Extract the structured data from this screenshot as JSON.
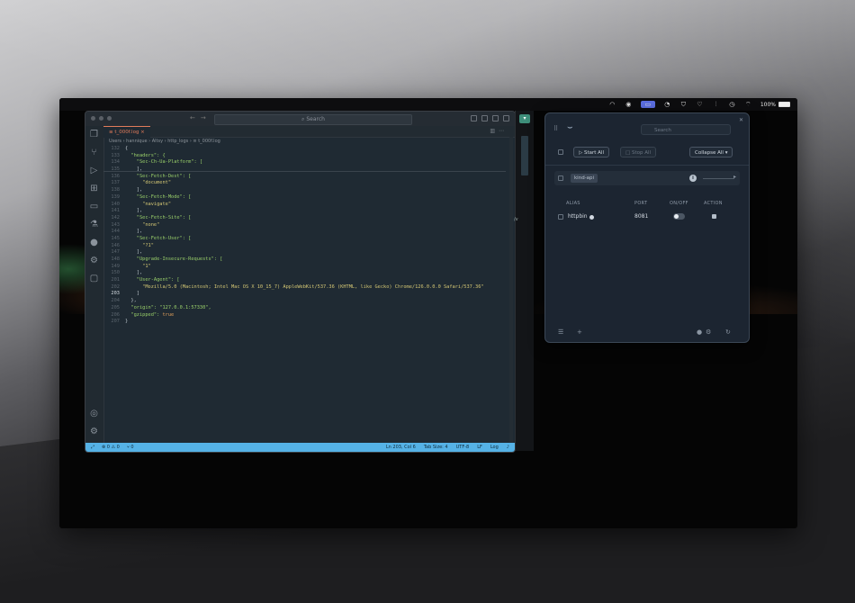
{
  "menubar": {
    "battery_text": "100%",
    "icons": [
      "menu-extra-icon",
      "record-icon",
      "port-manager-icon",
      "timer-icon",
      "shield-icon",
      "heart-monitor-icon",
      "audio-icon",
      "clock-icon",
      "wifi-icon"
    ]
  },
  "editor": {
    "search_placeholder": "Search",
    "tab_label": "t_000f.log",
    "breadcrumb": "Users  ›  hannique  ›  Altsy  ›  http_logs  ›  ≡ t_000f.log",
    "lines": [
      {
        "n": "132",
        "t": "{"
      },
      {
        "n": "133",
        "t": "  \"headers\": {"
      },
      {
        "n": "134",
        "t": "    \"Sec-Ch-Ua-Platform\": ["
      },
      {
        "n": "135",
        "t": "    ],"
      },
      {
        "n": "136",
        "t": "    \"Sec-Fetch-Dest\": ["
      },
      {
        "n": "137",
        "t": "      \"document\""
      },
      {
        "n": "138",
        "t": "    ],"
      },
      {
        "n": "139",
        "t": "    \"Sec-Fetch-Mode\": ["
      },
      {
        "n": "140",
        "t": "      \"navigate\""
      },
      {
        "n": "141",
        "t": "    ],"
      },
      {
        "n": "142",
        "t": "    \"Sec-Fetch-Site\": ["
      },
      {
        "n": "143",
        "t": "      \"none\""
      },
      {
        "n": "144",
        "t": "    ],"
      },
      {
        "n": "145",
        "t": "    \"Sec-Fetch-User\": ["
      },
      {
        "n": "146",
        "t": "      \"?1\""
      },
      {
        "n": "147",
        "t": "    ],"
      },
      {
        "n": "148",
        "t": "    \"Upgrade-Insecure-Requests\": ["
      },
      {
        "n": "149",
        "t": "      \"1\""
      },
      {
        "n": "150",
        "t": "    ],"
      },
      {
        "n": "201",
        "t": "    \"User-Agent\": ["
      },
      {
        "n": "202",
        "t": "      \"Mozilla/5.0 (Macintosh; Intel Mac OS X 10_15_7) AppleWebKit/537.36 (KHTML, like Gecko) Chrome/126.0.0.0 Safari/537.36\""
      },
      {
        "n": "203",
        "t": "    ]"
      },
      {
        "n": "204",
        "t": "  },"
      },
      {
        "n": "205",
        "t": "  \"origin\": \"127.0.0.1:57330\","
      },
      {
        "n": "206",
        "t": "  \"gzipped\": true"
      },
      {
        "n": "207",
        "t": "}"
      }
    ],
    "current_line": "203",
    "status": {
      "errors": "⊗ 0 ⚠ 0",
      "ports": "⑂ 0",
      "position": "Ln 203, Col 6",
      "tab_size": "Tab Size: 4",
      "encoding": "UTF-8",
      "eol": "LF",
      "language": "Log"
    }
  },
  "side_strip": {
    "chip": "▾",
    "text": "/v"
  },
  "panel": {
    "search_placeholder": "Search",
    "start_all": "Start All",
    "stop_all": "Stop All",
    "collapse_all": "Collapse All",
    "group_name": "kind-api",
    "columns": {
      "alias": "ALIAS",
      "port": "PORT",
      "onoff": "ON/OFF",
      "action": "ACTION"
    },
    "services": [
      {
        "alias": "httpbin",
        "port": "8081",
        "on": false
      }
    ]
  }
}
